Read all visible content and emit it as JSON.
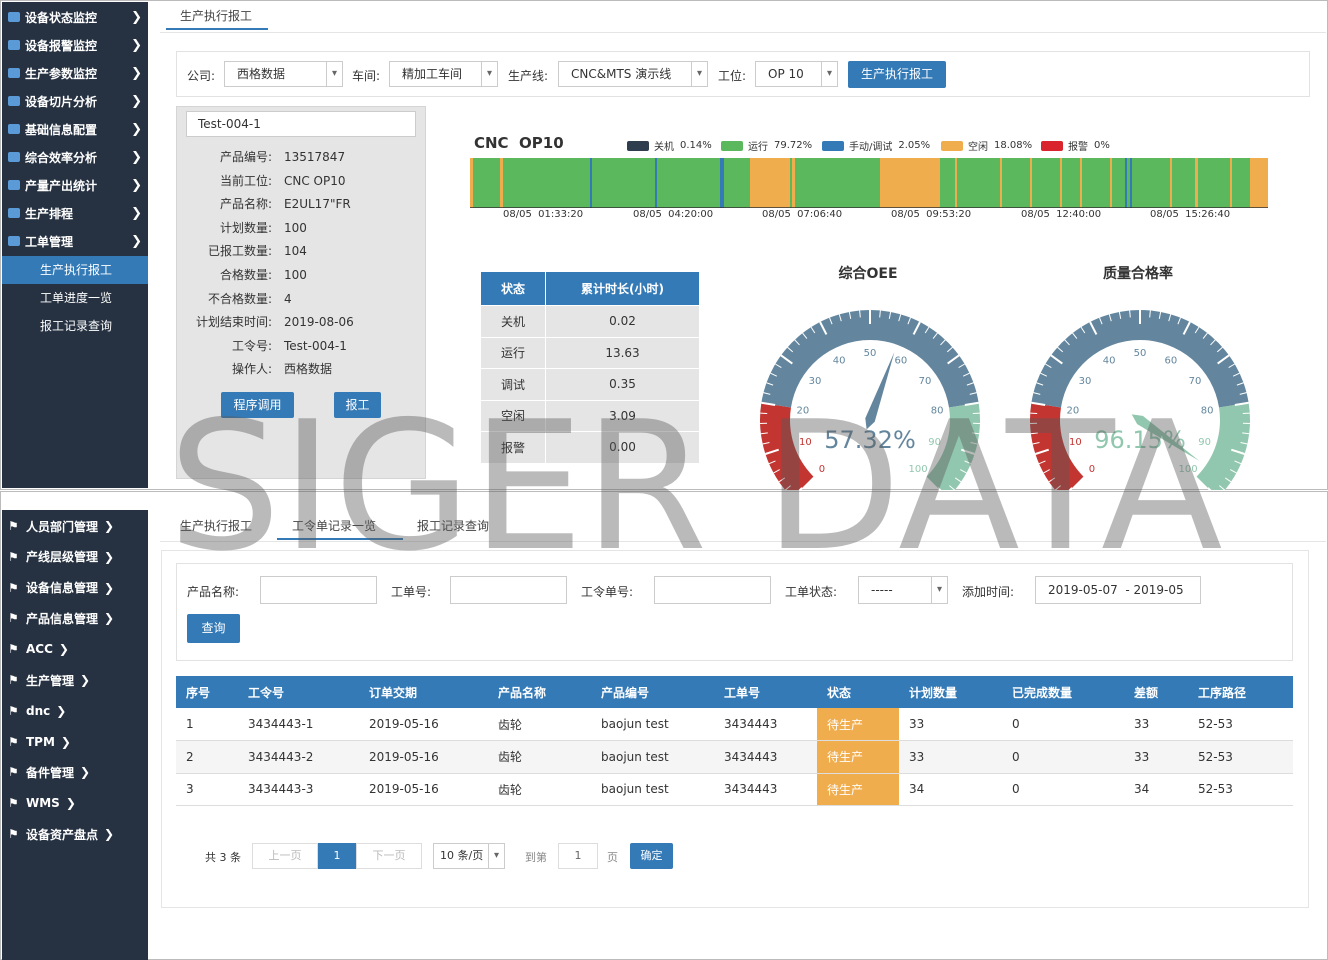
{
  "top_sidebar": {
    "items": [
      {
        "label": "设备状态监控",
        "icon": "monitor-icon"
      },
      {
        "label": "设备报警监控",
        "icon": "alarm-icon"
      },
      {
        "label": "生产参数监控",
        "icon": "params-icon"
      },
      {
        "label": "设备切片分析",
        "icon": "refresh-icon"
      },
      {
        "label": "基础信息配置",
        "icon": "gear-icon"
      },
      {
        "label": "综合效率分析",
        "icon": "pie-icon"
      },
      {
        "label": "产量产出统计",
        "icon": "chart-icon"
      },
      {
        "label": "生产排程",
        "icon": "calendar-icon"
      },
      {
        "label": "工单管理",
        "icon": "list-icon"
      }
    ],
    "subitems": [
      "生产执行报工",
      "工单进度一览",
      "报工记录查询"
    ]
  },
  "top_tab": "生产执行报工",
  "filters": {
    "company_label": "公司:",
    "company": "西格数据",
    "workshop_label": "车间:",
    "workshop": "精加工车间",
    "line_label": "生产线:",
    "line": "CNC&MTS 演示线",
    "station_label": "工位:",
    "station": "OP 10",
    "submit": "生产执行报工"
  },
  "info": {
    "order": "Test-004-1",
    "rows": [
      {
        "k": "产品编号:",
        "v": "13517847"
      },
      {
        "k": "当前工位:",
        "v": "CNC OP10"
      },
      {
        "k": "产品名称:",
        "v": "E2UL17\"FR"
      },
      {
        "k": "计划数量:",
        "v": "100"
      },
      {
        "k": "已报工数量:",
        "v": "104"
      },
      {
        "k": "合格数量:",
        "v": "100"
      },
      {
        "k": "不合格数量:",
        "v": "4"
      },
      {
        "k": "计划结束时间:",
        "v": "2019-08-06"
      },
      {
        "k": "工令号:",
        "v": "Test-004-1"
      },
      {
        "k": "操作人:",
        "v": "西格数据"
      }
    ],
    "btn_program": "程序调用",
    "btn_report": "报工"
  },
  "timeline": {
    "title": "CNC  OP10",
    "legend": [
      {
        "label": "关机",
        "pct": "0.14%",
        "color": "#2f3e4e"
      },
      {
        "label": "运行",
        "pct": "79.72%",
        "color": "#5cb85c"
      },
      {
        "label": "手动/调试",
        "pct": "2.05%",
        "color": "#337ab7"
      },
      {
        "label": "空闲",
        "pct": "18.08%",
        "color": "#f0ad4e"
      },
      {
        "label": "报警",
        "pct": "0%",
        "color": "#d9232d"
      }
    ],
    "ticks": [
      "08/05  01:33:20",
      "08/05  04:20:00",
      "08/05  07:06:40",
      "08/05  09:53:20",
      "08/05  12:40:00",
      "08/05  15:26:40"
    ]
  },
  "status_table": {
    "h1": "状态",
    "h2": "累计时长(小时)",
    "rows": [
      {
        "s": "关机",
        "v": "0.02"
      },
      {
        "s": "运行",
        "v": "13.63"
      },
      {
        "s": "调试",
        "v": "0.35"
      },
      {
        "s": "空闲",
        "v": "3.09"
      },
      {
        "s": "报警",
        "v": "0.00"
      }
    ]
  },
  "gauges": [
    {
      "title": "综合OEE",
      "value": 57.32,
      "label": "57.32%"
    },
    {
      "title": "质量合格率",
      "value": 96.15,
      "label": "96.15%"
    }
  ],
  "gauge_scale": [
    "0",
    "10",
    "20",
    "30",
    "40",
    "50",
    "60",
    "70",
    "80",
    "90",
    "100"
  ],
  "watermark": "SIGER DATA",
  "bottom_sidebar": {
    "items": [
      "人员部门管理",
      "产线层级管理",
      "设备信息管理",
      "产品信息管理",
      "ACC",
      "生产管理",
      "dnc",
      "TPM",
      "备件管理",
      "WMS",
      "设备资产盘点"
    ]
  },
  "bottom_tabs": [
    "生产执行报工",
    "工令单记录一览",
    "报工记录查询"
  ],
  "search": {
    "name_label": "产品名称:",
    "wo_label": "工单号:",
    "order_label": "工令单号:",
    "status_label": "工单状态:",
    "status": "-----",
    "time_label": "添加时间:",
    "time": "2019-05-07  - 2019-05",
    "query": "查询"
  },
  "orders": {
    "headers": [
      "序号",
      "工令号",
      "订单交期",
      "产品名称",
      "产品编号",
      "工单号",
      "状态",
      "计划数量",
      "已完成数量",
      "差额",
      "工序路径"
    ],
    "rows": [
      [
        "1",
        "3434443-1",
        "2019-05-16",
        "齿轮",
        "baojun test",
        "3434443",
        "待生产",
        "33",
        "0",
        "33",
        "52-53"
      ],
      [
        "2",
        "3434443-2",
        "2019-05-16",
        "齿轮",
        "baojun test",
        "3434443",
        "待生产",
        "33",
        "0",
        "33",
        "52-53"
      ],
      [
        "3",
        "3434443-3",
        "2019-05-16",
        "齿轮",
        "baojun test",
        "3434443",
        "待生产",
        "34",
        "0",
        "34",
        "52-53"
      ]
    ]
  },
  "pagination": {
    "total": "共 3 条",
    "prev": "上一页",
    "page": "1",
    "next": "下一页",
    "size": "10 条/页",
    "goto": "到第",
    "goto_val": "1",
    "page_unit": "页",
    "confirm": "确定"
  }
}
